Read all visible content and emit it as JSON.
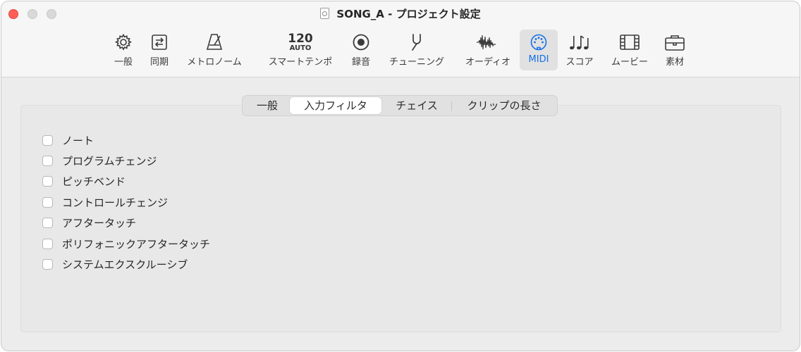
{
  "window": {
    "title": "SONG_A - プロジェクト設定"
  },
  "toolbar": {
    "items": [
      {
        "label": "一般",
        "icon": "gear-icon"
      },
      {
        "label": "同期",
        "icon": "sync-icon"
      },
      {
        "label": "メトロノーム",
        "icon": "metronome-icon"
      },
      {
        "label": "スマートテンポ",
        "icon": "smart-tempo-icon",
        "tempo_number": "120",
        "tempo_mode": "AUTO"
      },
      {
        "label": "録音",
        "icon": "record-icon"
      },
      {
        "label": "チューニング",
        "icon": "tuning-fork-icon"
      },
      {
        "label": "オーディオ",
        "icon": "waveform-icon"
      },
      {
        "label": "MIDI",
        "icon": "midi-port-icon",
        "active": true
      },
      {
        "label": "スコア",
        "icon": "music-notes-icon"
      },
      {
        "label": "ムービー",
        "icon": "film-icon"
      },
      {
        "label": "素材",
        "icon": "briefcase-icon"
      }
    ],
    "active_color": "#1570e8"
  },
  "tabs": {
    "items": [
      "一般",
      "入力フィルタ",
      "チェイス",
      "クリップの長さ"
    ],
    "selected": "入力フィルタ"
  },
  "filters": [
    {
      "label": "ノート",
      "checked": false
    },
    {
      "label": "プログラムチェンジ",
      "checked": false
    },
    {
      "label": "ピッチベンド",
      "checked": false
    },
    {
      "label": "コントロールチェンジ",
      "checked": false
    },
    {
      "label": "アフタータッチ",
      "checked": false
    },
    {
      "label": "ポリフォニックアフタータッチ",
      "checked": false
    },
    {
      "label": "システムエクスクルーシブ",
      "checked": false
    }
  ]
}
